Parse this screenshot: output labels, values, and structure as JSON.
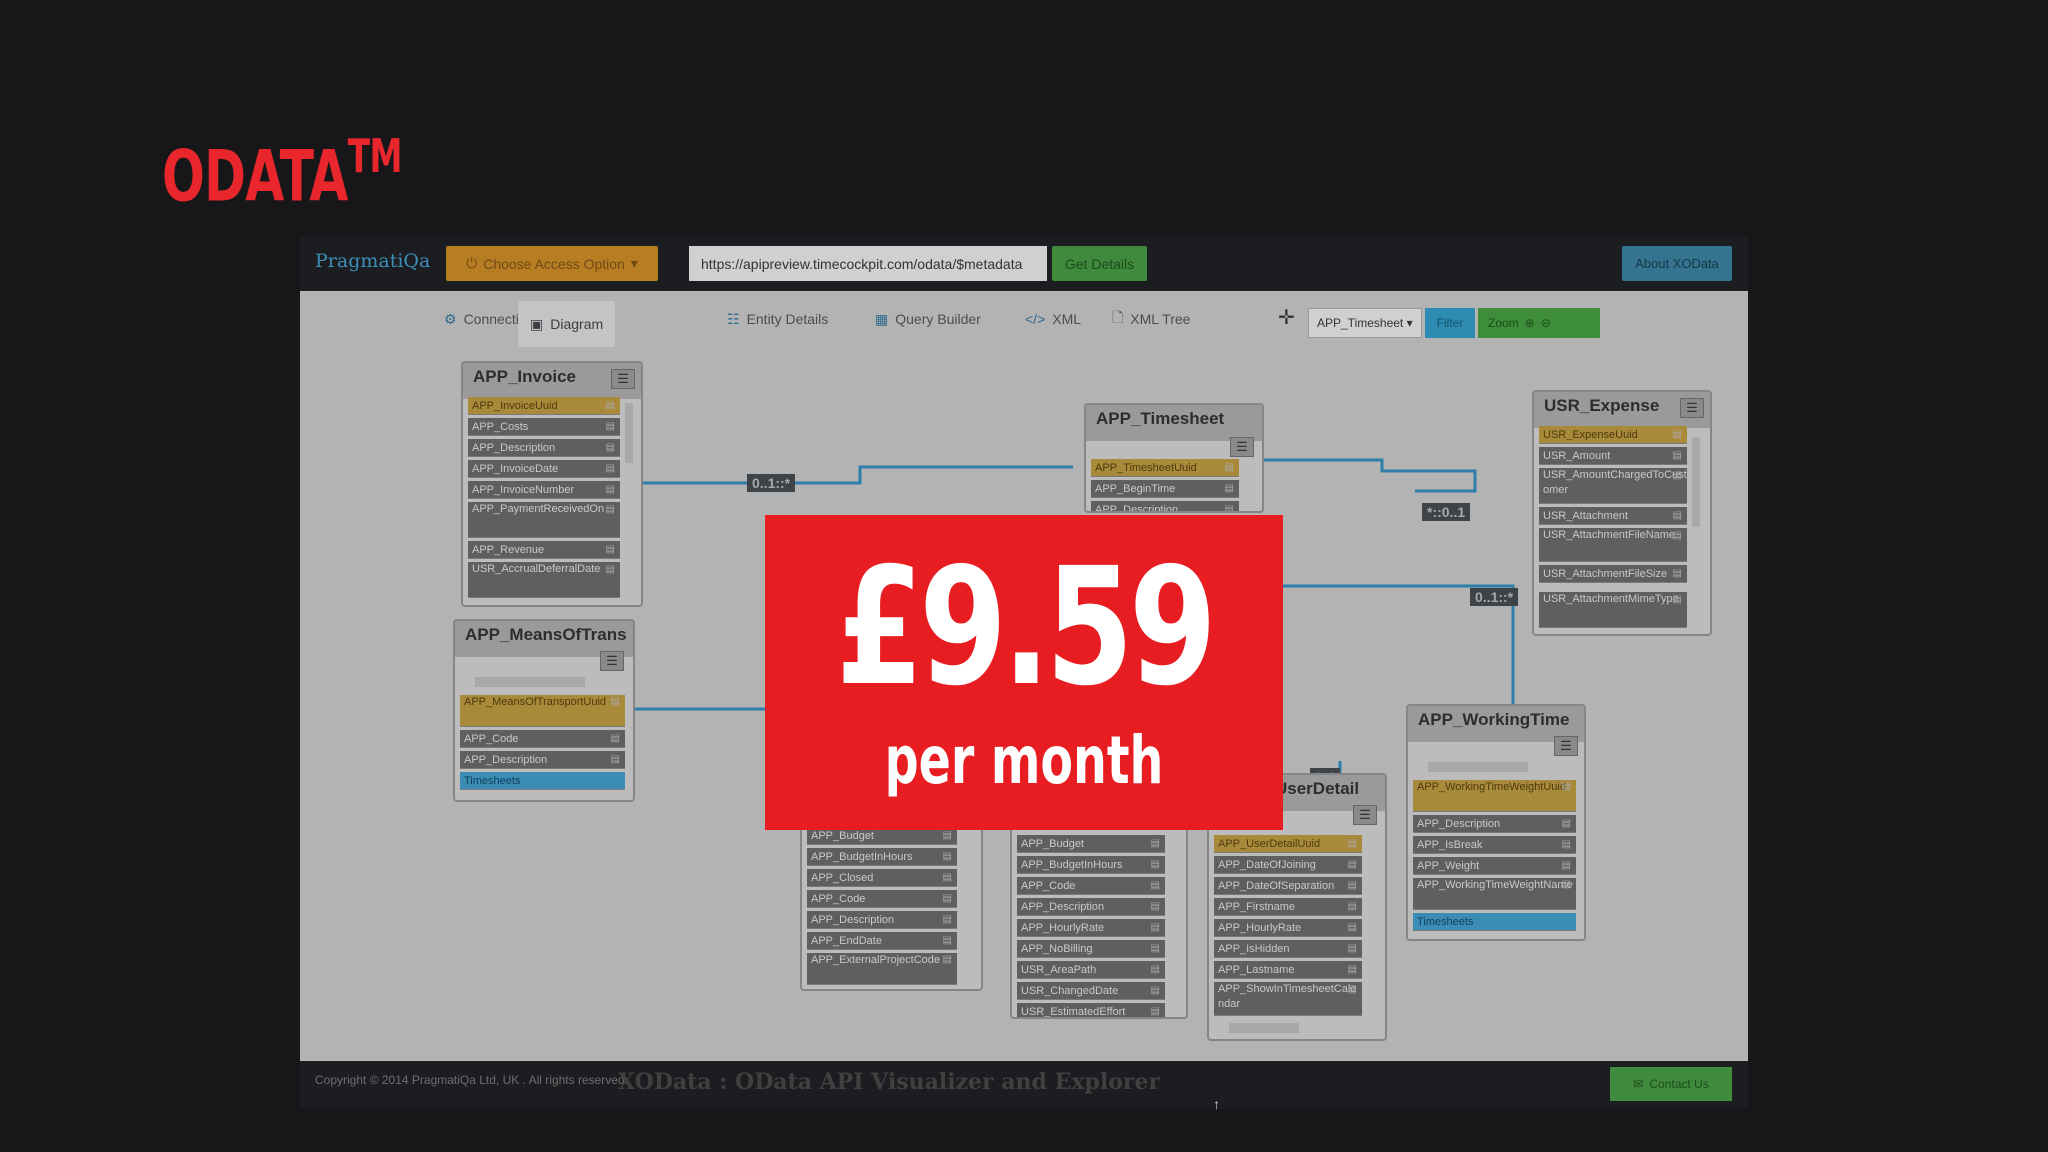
{
  "brand": {
    "name": "ODATA",
    "tm": "TM"
  },
  "app": {
    "logo": "PragmatiQa",
    "access_button": "Choose Access Option",
    "url_value": "https://apipreview.timecockpit.com/odata/$metadata",
    "get_details": "Get Details",
    "about": "About XOData"
  },
  "tabs": [
    {
      "label": "Connection",
      "icon": "gear-icon"
    },
    {
      "label": "Diagram",
      "icon": "image-icon"
    },
    {
      "label": "Entity Details",
      "icon": "grid-icon"
    },
    {
      "label": "Query Builder",
      "icon": "table-icon"
    },
    {
      "label": "XML",
      "icon": "code-icon"
    },
    {
      "label": "XML Tree",
      "icon": "file-icon"
    }
  ],
  "toolbar": {
    "entity_select": "APP_Timesheet",
    "filter": "Filter",
    "zoom": "Zoom"
  },
  "entities": {
    "invoice": {
      "title": "APP_Invoice",
      "rows": [
        "APP_InvoiceUuid",
        "APP_Costs",
        "APP_Description",
        "APP_InvoiceDate",
        "APP_InvoiceNumber",
        "APP_PaymentReceivedOn",
        "APP_Revenue",
        "USR_AccrualDeferralDate"
      ]
    },
    "transport": {
      "title": "APP_MeansOfTrans",
      "rows": [
        "APP_MeansOfTransportUuid",
        "APP_Code",
        "APP_Description",
        "Timesheets"
      ]
    },
    "timesheet": {
      "title": "APP_Timesheet",
      "rows": [
        "APP_TimesheetUuid",
        "APP_BeginTime",
        "APP_Description"
      ]
    },
    "expense": {
      "title": "USR_Expense",
      "rows": [
        "USR_ExpenseUuid",
        "USR_Amount",
        "USR_AmountChargedToCustomer",
        "USR_Attachment",
        "USR_AttachmentFileName",
        "USR_AttachmentFileSize",
        "USR_AttachmentMimeType"
      ]
    },
    "project": {
      "rows": [
        "APP_Budget",
        "APP_BudgetInHours",
        "APP_Closed",
        "APP_Code",
        "APP_Description",
        "APP_EndDate",
        "APP_ExternalProjectCode"
      ]
    },
    "task": {
      "rows": [
        "APP_Budget",
        "APP_BudgetInHours",
        "APP_Code",
        "APP_Description",
        "APP_HourlyRate",
        "APP_NoBilling",
        "USR_AreaPath",
        "USR_ChangedDate",
        "USR_EstimatedEffort"
      ]
    },
    "userdetail": {
      "title": "UserDetail",
      "rows": [
        "APP_UserDetailUuid",
        "APP_DateOfJoining",
        "APP_DateOfSeparation",
        "APP_Firstname",
        "APP_HourlyRate",
        "APP_IsHidden",
        "APP_Lastname",
        "APP_ShowInTimesheetCalendar"
      ]
    },
    "workingtime": {
      "title": "APP_WorkingTime",
      "rows": [
        "APP_WorkingTimeWeightUuid",
        "APP_Description",
        "APP_IsBreak",
        "APP_Weight",
        "APP_WorkingTimeWeightName",
        "Timesheets"
      ]
    }
  },
  "multiplicities": [
    "0..1::*",
    "*::0..1",
    "0..1::*",
    "*::*"
  ],
  "footer": {
    "copyright": "Copyright © 2014 PragmatiQa Ltd, UK . All rights reserved.",
    "title": "XOData : OData API Visualizer and Explorer",
    "contact": "Contact Us"
  },
  "offer": {
    "price": "£9.59",
    "period": "per month"
  },
  "colors": {
    "brand_red": "#e8262b",
    "offer_red": "#e81d21",
    "key_row": "#a88a3a",
    "nav_row": "#3c8db5"
  }
}
